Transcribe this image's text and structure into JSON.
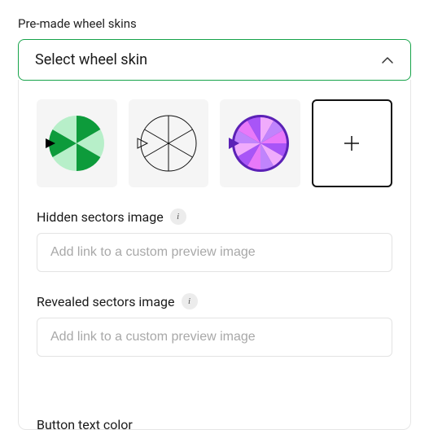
{
  "header": {
    "label": "Pre-made wheel skins"
  },
  "select": {
    "text": "Select wheel skin"
  },
  "skins": {
    "tile1_name": "wheel-skin-green",
    "tile2_name": "wheel-skin-outline",
    "tile3_name": "wheel-skin-purple",
    "add_symbol": "+"
  },
  "fields": {
    "hidden": {
      "label": "Hidden sectors image",
      "info": "i",
      "placeholder": "Add link to a custom preview image"
    },
    "revealed": {
      "label": "Revealed sectors image",
      "info": "i",
      "placeholder": "Add link to a custom preview image"
    }
  },
  "cutoff": {
    "label": "Button text color"
  }
}
